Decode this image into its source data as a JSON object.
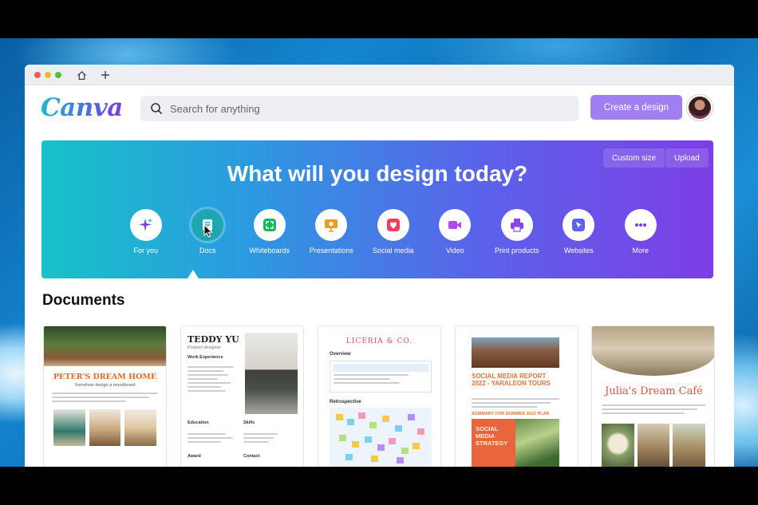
{
  "header": {
    "logo": "Canva",
    "search_placeholder": "Search for anything",
    "create_label": "Create a design"
  },
  "hero": {
    "title": "What will you design today?",
    "custom_size": "Custom size",
    "upload": "Upload",
    "categories": [
      {
        "label": "For you",
        "icon": "sparkle-icon",
        "color": "#7d3ee6"
      },
      {
        "label": "Docs",
        "icon": "doc-icon",
        "color": "#1ea7b3"
      },
      {
        "label": "Whiteboards",
        "icon": "whiteboard-icon",
        "color": "#1bb35f"
      },
      {
        "label": "Presentations",
        "icon": "presentation-icon",
        "color": "#f59a20"
      },
      {
        "label": "Social media",
        "icon": "heart-icon",
        "color": "#ef3f5d"
      },
      {
        "label": "Video",
        "icon": "video-icon",
        "color": "#b04bea"
      },
      {
        "label": "Print products",
        "icon": "printer-icon",
        "color": "#8b45e6"
      },
      {
        "label": "Websites",
        "icon": "cursor-icon",
        "color": "#5a63ea"
      },
      {
        "label": "More",
        "icon": "more-icon",
        "color": "#7a3ee0"
      }
    ]
  },
  "section_title": "Documents",
  "documents": {
    "d1": {
      "title": "PETER'S DREAM HOME",
      "subtitle": "Somehow design a moodboard"
    },
    "d2": {
      "name": "TEDDY YU",
      "role": "Product designer",
      "work": "Work Experience",
      "education": "Education",
      "skills": "Skills",
      "award": "Award",
      "contact": "Contact"
    },
    "d3": {
      "title": "LICERIA & CO.",
      "overview": "Overview",
      "retro": "Retrospective"
    },
    "d4": {
      "title": "SOCIAL MEDIA REPORT 2022 - YARALEON TOURS",
      "sub": "SUMMARY FOR SUMMER 2022 PLAN",
      "card": "SOCIAL MEDIA STRATEGY"
    },
    "d5": {
      "title": "Julia's Dream Café"
    }
  }
}
